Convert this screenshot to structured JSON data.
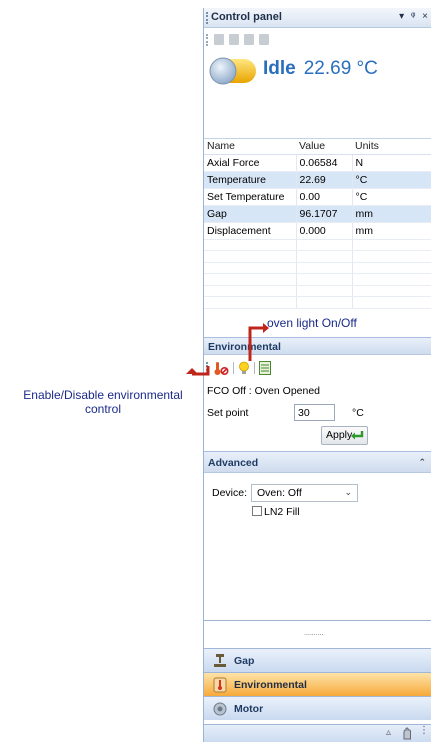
{
  "panel": {
    "title": "Control panel",
    "title_controls": "▾ ᵠ ×"
  },
  "status": {
    "state": "Idle",
    "temperature": "22.69 °C"
  },
  "grid": {
    "columns": [
      "Name",
      "Value",
      "Units"
    ],
    "rows": [
      {
        "name": "Axial Force",
        "value": "0.06584",
        "units": "N"
      },
      {
        "name": "Temperature",
        "value": "22.69",
        "units": "°C"
      },
      {
        "name": "Set Temperature",
        "value": "0.00",
        "units": "°C"
      },
      {
        "name": "Gap",
        "value": "96.1707",
        "units": "mm"
      },
      {
        "name": "Displacement",
        "value": "0.000",
        "units": "mm"
      }
    ]
  },
  "environmental": {
    "header": "Environmental",
    "fco_status": "FCO Off : Oven Opened",
    "setpoint_label": "Set point",
    "setpoint_value": "30",
    "setpoint_unit": "°C",
    "apply_label": "Apply"
  },
  "advanced": {
    "header": "Advanced",
    "device_label": "Device:",
    "device_value": "Oven: Off",
    "ln2_label": "LN2 Fill"
  },
  "splitter": "..........",
  "nav": {
    "gap": "Gap",
    "environmental": "Environmental",
    "motor": "Motor"
  },
  "annotations": {
    "oven_light": "oven light On/Off",
    "env_control": "Enable/Disable environmental control"
  },
  "colors": {
    "accent_blue": "#2a6fbd",
    "active_nav": "#f7a93a",
    "alt_row": "#d7e6f7",
    "annotation_arrow": "#c0251b"
  }
}
